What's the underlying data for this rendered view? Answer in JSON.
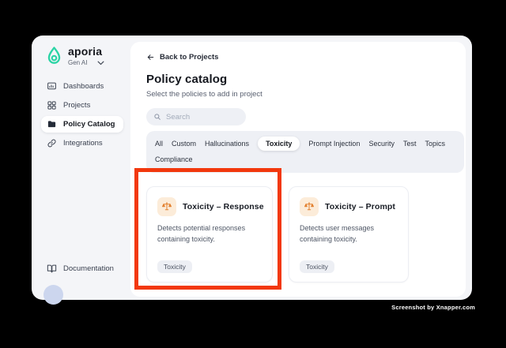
{
  "colors": {
    "brand_teal": "#2bd4a5",
    "highlight_red": "#f2380d",
    "policy_icon_orange": "#e2802f",
    "policy_icon_bg": "#fcecd9"
  },
  "brand": {
    "name": "aporia",
    "workspace": "Gen AI"
  },
  "sidebar": {
    "items": [
      {
        "label": "Dashboards"
      },
      {
        "label": "Projects"
      },
      {
        "label": "Policy Catalog",
        "active": true
      },
      {
        "label": "Integrations"
      }
    ],
    "documentation_label": "Documentation"
  },
  "main": {
    "back_link": "Back to Projects",
    "title": "Policy catalog",
    "subtitle": "Select the policies to add in project",
    "search": {
      "placeholder": "Search"
    },
    "filter_tabs": {
      "row1": [
        {
          "label": "All"
        },
        {
          "label": "Custom"
        },
        {
          "label": "Hallucinations"
        },
        {
          "label": "Toxicity",
          "selected": true
        },
        {
          "label": "Prompt Injection"
        },
        {
          "label": "Security"
        },
        {
          "label": "Test"
        },
        {
          "label": "Topics"
        }
      ],
      "row2": [
        {
          "label": "Compliance"
        }
      ]
    },
    "cards": [
      {
        "title": "Toxicity – Response",
        "description": "Detects potential responses containing toxicity.",
        "tag": "Toxicity"
      },
      {
        "title": "Toxicity – Prompt",
        "description": "Detects user messages containing toxicity.",
        "tag": "Toxicity"
      }
    ]
  },
  "watermark": "Screenshot by Xnapper.com"
}
